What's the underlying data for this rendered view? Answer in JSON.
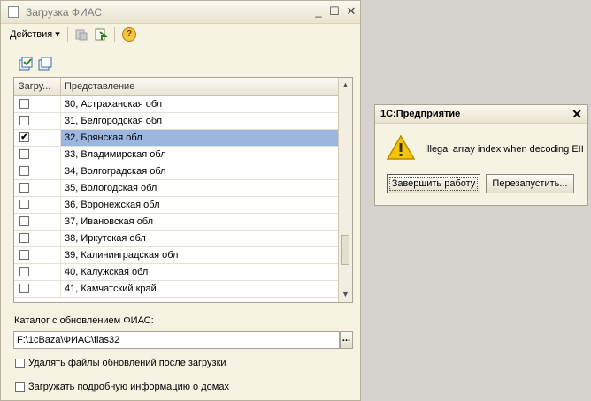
{
  "window": {
    "title": "Загрузка ФИАС",
    "minimize_glyph": "_",
    "maximize_glyph": "☐",
    "close_glyph": "✕"
  },
  "toolbar": {
    "actions_label": "Действия",
    "actions_arrow": "▾",
    "help_glyph": "?"
  },
  "grid": {
    "columns": [
      "Загру...",
      "Представление"
    ],
    "rows": [
      {
        "label": "30, Астраханская обл",
        "checked": false
      },
      {
        "label": "31, Белгородская обл",
        "checked": false
      },
      {
        "label": "32, Брянская обл",
        "checked": true
      },
      {
        "label": "33, Владимирская обл",
        "checked": false
      },
      {
        "label": "34, Волгоградская обл",
        "checked": false
      },
      {
        "label": "35, Вологодская обл",
        "checked": false
      },
      {
        "label": "36, Воронежская обл",
        "checked": false
      },
      {
        "label": "37, Ивановская обл",
        "checked": false
      },
      {
        "label": "38, Иркутская обл",
        "checked": false
      },
      {
        "label": "39, Калининградская обл",
        "checked": false
      },
      {
        "label": "40, Калужская обл",
        "checked": false
      },
      {
        "label": "41, Камчатский край",
        "checked": false
      }
    ],
    "check_glyph": "✔",
    "scroll_up": "▲",
    "scroll_down": "▼"
  },
  "catalog": {
    "label": "Каталог с обновлением ФИАС:",
    "path": "F:\\1cBaza\\ФИАС\\fias32",
    "browse_label": "..."
  },
  "options": [
    {
      "label": "Удалять файлы обновлений после загрузки",
      "checked": false
    },
    {
      "label": "Загружать подробную информацию о домах",
      "checked": false
    }
  ],
  "dialog": {
    "title": "1С:Предприятие",
    "close_glyph": "✕",
    "message": "Illegal array index when decoding EII",
    "buttons": [
      "Завершить работу",
      "Перезапустить..."
    ]
  },
  "colors": {
    "selected_row": "#9bb7e0",
    "warning": "#f5c400"
  }
}
